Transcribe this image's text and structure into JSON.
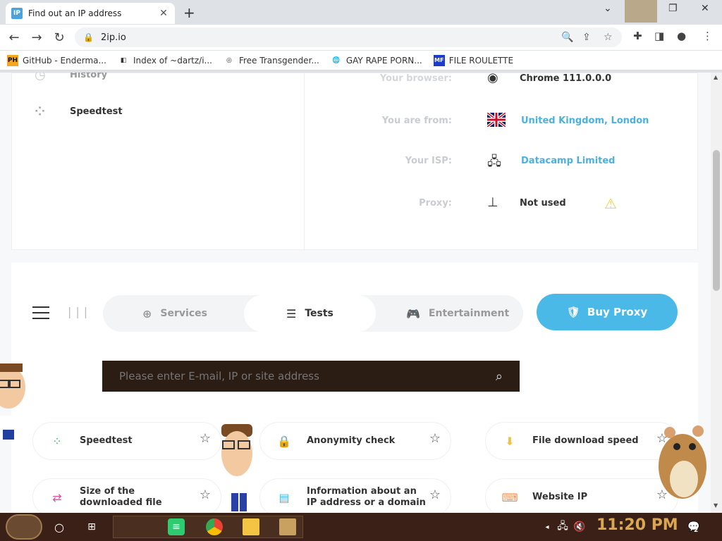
{
  "browser": {
    "tab_title": "Find out an IP address",
    "favicon": "IP",
    "close_tab": "✕",
    "new_tab": "+",
    "url": "2ip.io",
    "bookmarks": [
      {
        "label": "GitHub - Enderma...",
        "icon": "PH",
        "color": "#f5a623"
      },
      {
        "label": "Index of ~dartz/i...",
        "icon": "◧",
        "color": "#333"
      },
      {
        "label": "Free Transgender...",
        "icon": "◎",
        "color": "#333"
      },
      {
        "label": "GAY RAPE PORN...",
        "icon": "🌐",
        "color": "#555"
      },
      {
        "label": "FILE ROULETTE",
        "icon": "MF",
        "color": "#1a3ccf"
      }
    ]
  },
  "sidebar": {
    "history_label": "History",
    "speedtest_label": "Speedtest"
  },
  "info": {
    "browser_label": "Your browser:",
    "browser_value": "Chrome 111.0.0.0",
    "from_label": "You are from:",
    "from_value": "United Kingdom, London",
    "isp_label": "Your ISP:",
    "isp_value": "Datacamp Limited",
    "proxy_label": "Proxy:",
    "proxy_value": "Not used"
  },
  "nav": {
    "services": "Services",
    "tests": "Tests",
    "entertainment": "Entertainment",
    "buy_proxy": "Buy Proxy"
  },
  "search": {
    "placeholder": "Please enter E-mail, IP or site address"
  },
  "tests": [
    {
      "label": "Speedtest",
      "icon": "⁘",
      "color": "#3cc15a"
    },
    {
      "label": "Anonymity check",
      "icon": "🔒",
      "color": "#9a6de0"
    },
    {
      "label": "File download speed",
      "icon": "⬇",
      "color": "#f0c040"
    },
    {
      "label": "Size of the downloaded file",
      "icon": "⇄",
      "color": "#e14c9a"
    },
    {
      "label": "Information about an IP address or a domain",
      "icon": "▤",
      "color": "#4ab9e8"
    },
    {
      "label": "Website IP",
      "icon": "⌨",
      "color": "#f09050"
    }
  ],
  "taskbar": {
    "time": "11:20 PM",
    "notification_count": "2"
  }
}
